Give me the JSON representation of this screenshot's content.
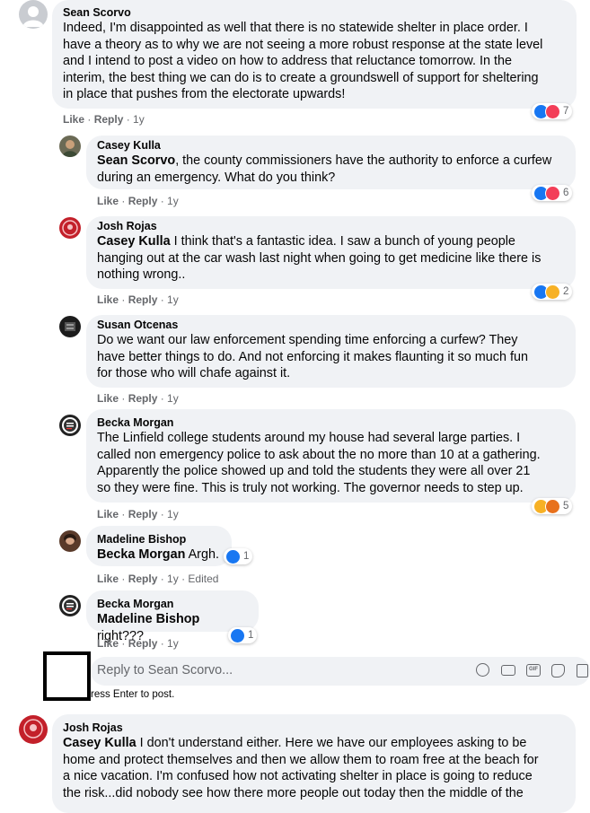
{
  "comments": [
    {
      "author": "Sean Scorvo",
      "lines": [
        "Indeed, I'm disappointed as well that there is no statewide shelter in place order. I",
        "have a theory as to why we are not seeing a more robust response at the state level",
        "and I intend to post a video on how to address that reluctance tomorrow. In the",
        "interim, the best thing we can do is to create a groundswell of support for sheltering",
        "in place that pushes from the electorate upwards!"
      ],
      "like": "Like",
      "reply": "Reply",
      "time": "1y",
      "reaction_count": "7"
    },
    {
      "author": "Casey Kulla",
      "mention": "Sean Scorvo",
      "lines": [
        ", the county commissioners have the authority to enforce a curfew",
        "during an emergency. What do you think?"
      ],
      "like": "Like",
      "reply": "Reply",
      "time": "1y",
      "reaction_count": "6"
    },
    {
      "author": "Josh Rojas",
      "mention": "Casey Kulla",
      "lines": [
        " I think that's a fantastic idea. I saw a bunch of young people",
        "hanging out at the car wash last night when going to get medicine like there is",
        "nothing wrong.."
      ],
      "like": "Like",
      "reply": "Reply",
      "time": "1y",
      "reaction_count": "2"
    },
    {
      "author": "Susan Otcenas",
      "lines": [
        "Do we want our law enforcement spending time enforcing a curfew? They",
        "have better things to do. And not enforcing it makes flaunting it so much fun",
        "for those who will chafe against it."
      ],
      "like": "Like",
      "reply": "Reply",
      "time": "1y"
    },
    {
      "author": "Becka Morgan",
      "lines": [
        "The Linfield college students around my house had several large parties. I",
        "called non emergency police to ask about the no more than 10 at a gathering.",
        "Apparently the police showed up and told the students they were all over 21",
        "so they were fine. This is truly not working. The governor needs to step up."
      ],
      "like": "Like",
      "reply": "Reply",
      "time": "1y",
      "reaction_count": "5"
    },
    {
      "author": "Madeline Bishop",
      "mention": "Becka Morgan",
      "lines": [
        " Argh."
      ],
      "like": "Like",
      "reply": "Reply",
      "time": "1y",
      "edited": "Edited",
      "reaction_count": "1"
    },
    {
      "author": "Becka Morgan",
      "mention": "Madeline Bishop",
      "lines": [
        " right???"
      ],
      "like": "Like",
      "reply": "Reply",
      "time": "1y",
      "reaction_count": "1"
    },
    {
      "author": "Josh Rojas",
      "mention": "Casey Kulla",
      "lines": [
        " I don't understand either. Here we have our employees asking to be",
        "home and protect themselves and then we allow them to roam free at the beach for",
        "a nice vacation. I'm confused how not activating shelter in place is going to reduce",
        "the risk...did nobody see how there more people out today then the middle of the"
      ]
    }
  ],
  "reply_box": {
    "placeholder": "Reply to Sean Scorvo...",
    "hint": "ress Enter to post."
  },
  "colors": {
    "bubble": "#f0f2f5",
    "meta": "#65676b",
    "like_blue": "#1877f2",
    "love_red": "#f33e58",
    "wow_yellow": "#f7b125"
  }
}
